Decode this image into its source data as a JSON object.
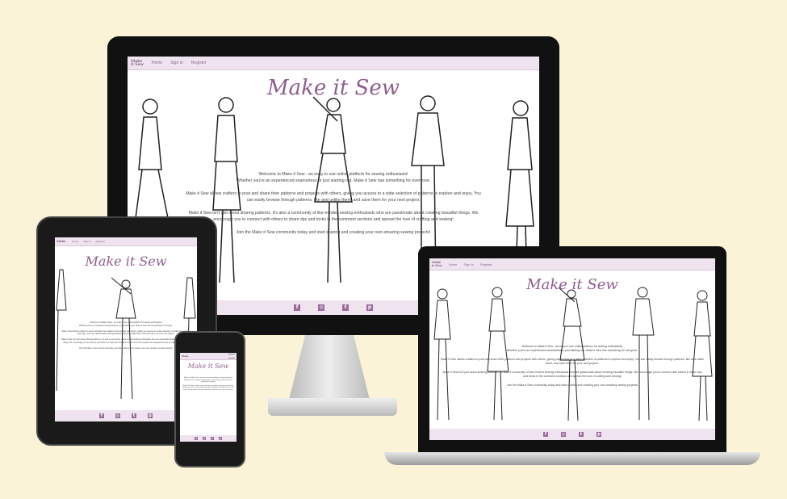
{
  "site": {
    "logo_line1": "Make",
    "logo_line2": "it Sew",
    "nav": [
      "Home",
      "Sign In",
      "Register"
    ],
    "title": "Make it Sew",
    "intro": [
      "Welcome to Make it Sew - an easy to use online platform for sewing enthusiasts!",
      "Whether you're an experienced seamstress or just starting out, Make it Sew has something for everyone.",
      "Make it Sew allows crafters to post and share their patterns and projects with others, giving you access to a wide selection of patterns to explore and enjoy. You can easily browse through patterns, like and unlike them, and save them for your next project.",
      "Make it Sew isn't just about sharing patterns, it's also a community of like-minded sewing enthusiasts who are passionate about creating beautiful things. We encourage you to connect with others to share tips and tricks in the comment sections and spread the love of crafting and sewing!",
      "Join the Make it Sew community today and start sharing and creating your own amazing sewing projects!"
    ],
    "footer_icons": [
      "facebook-icon",
      "instagram-icon",
      "twitter-icon",
      "pinterest-icon"
    ],
    "footer_glyphs": [
      "f",
      "◎",
      "t",
      "p"
    ]
  },
  "colors": {
    "background": "#fbf3d8",
    "nav": "#efe3ef",
    "accent": "#8e5d8e"
  }
}
